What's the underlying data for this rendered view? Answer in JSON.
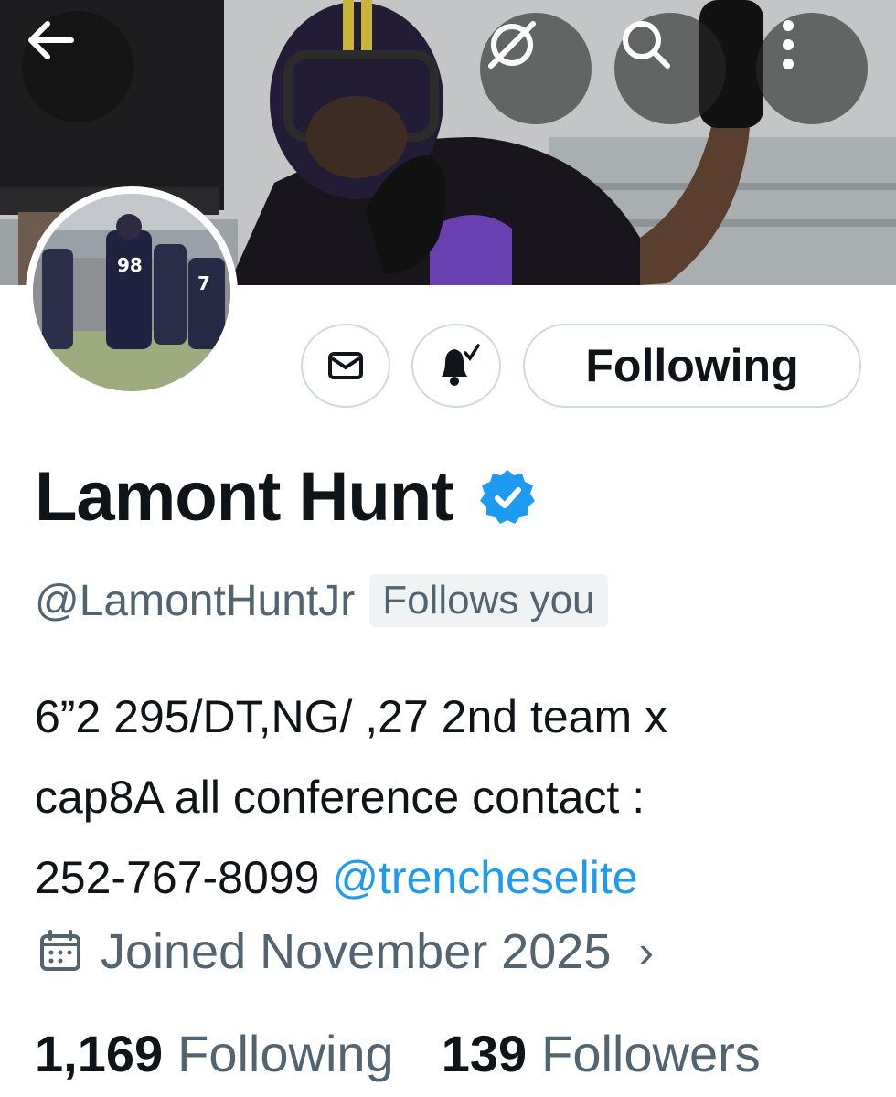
{
  "header": {
    "back_icon": "arrow-left-icon",
    "grok_icon": "grok-icon",
    "search_icon": "search-icon",
    "more_icon": "more-vertical-icon"
  },
  "actions": {
    "message_icon": "envelope-icon",
    "notifications_icon": "bell-check-icon",
    "following_label": "Following"
  },
  "profile": {
    "display_name": "Lamont Hunt",
    "verified": true,
    "handle": "@LamontHuntJr",
    "follows_you_label": "Follows you",
    "bio": {
      "line1": "6”2 295/DT,NG/ ,27 2nd team x",
      "line2": "cap8A all conference contact :",
      "line3_text": "252-767-8099 ",
      "line3_mention": "@trencheselite"
    },
    "joined": "Joined November 2025",
    "joined_chevron": "›",
    "following_count": "1,169",
    "following_label": "Following",
    "followers_count": "139",
    "followers_label": "Followers"
  },
  "colors": {
    "accent": "#1d9bf0",
    "secondary_text": "#536471",
    "primary_text": "#0f1419",
    "border": "#cfd9de"
  }
}
